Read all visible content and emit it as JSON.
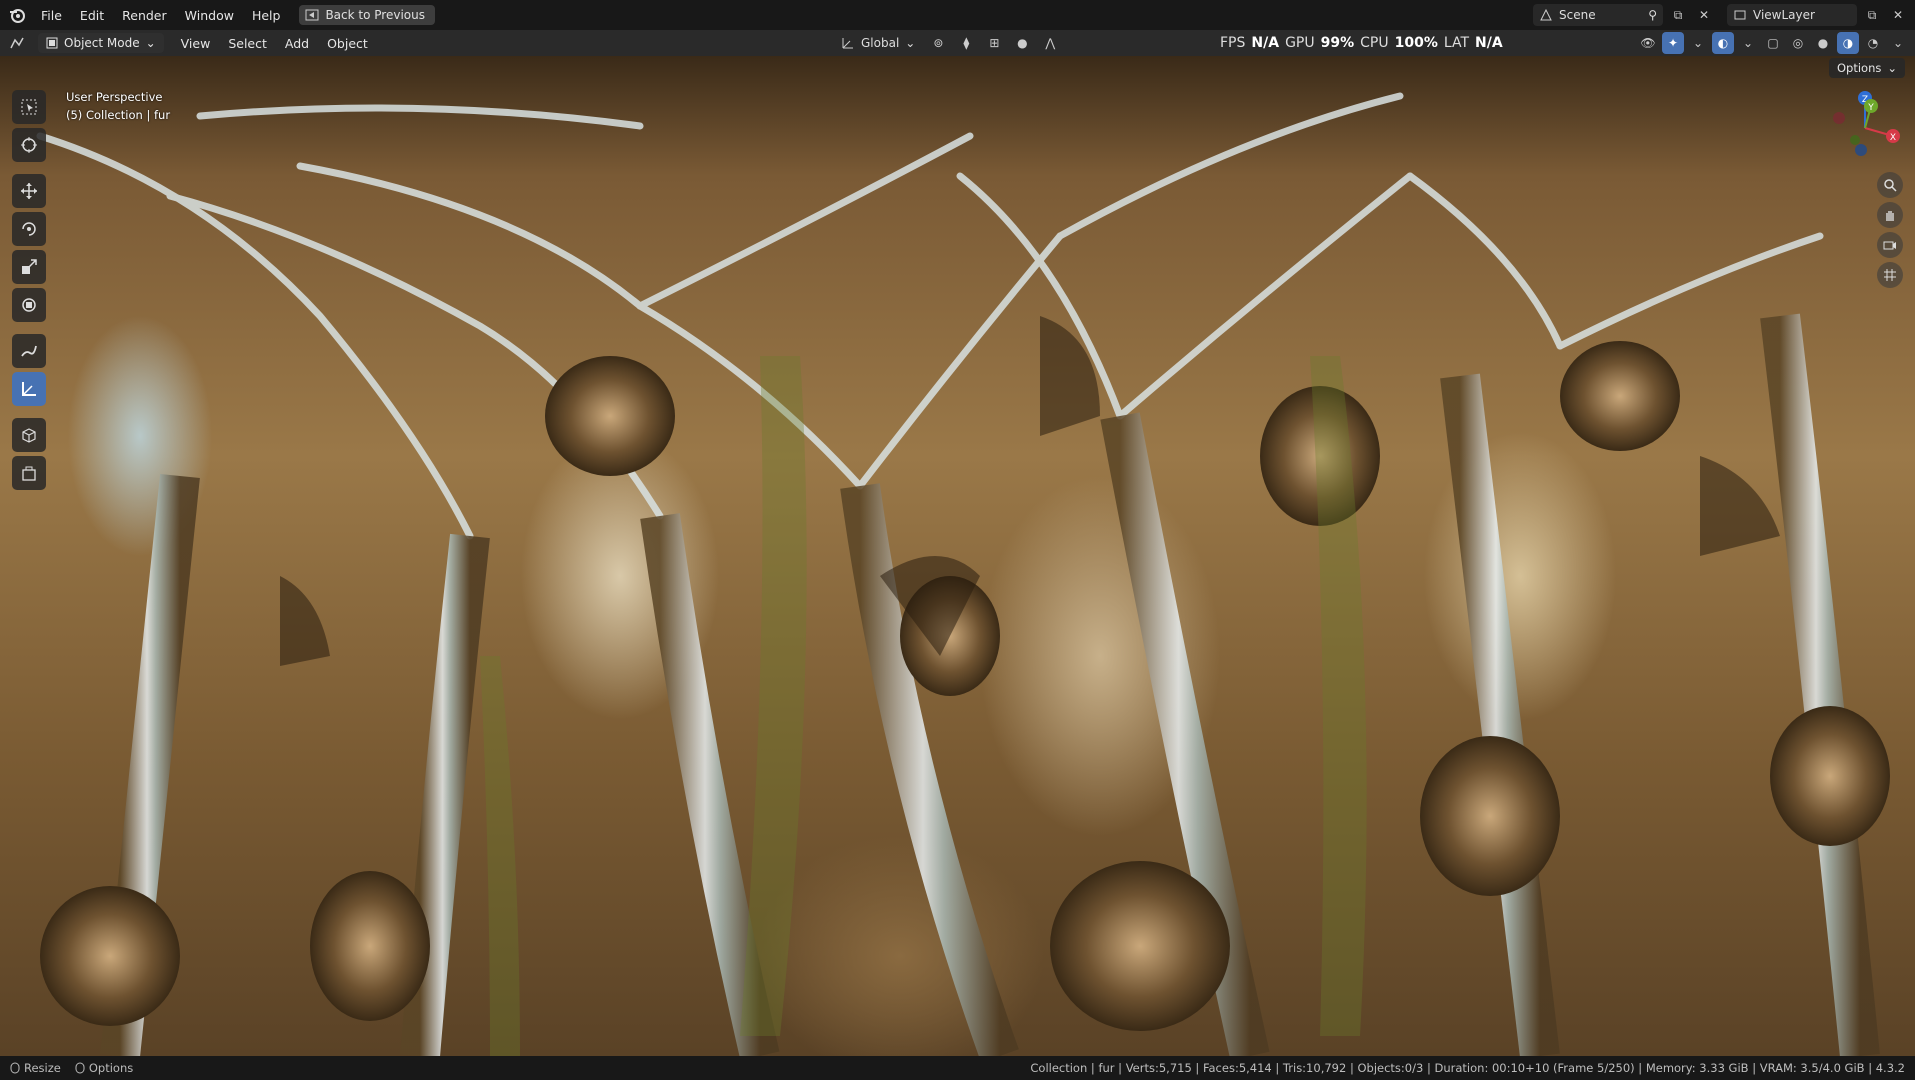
{
  "menubar": {
    "items": [
      "File",
      "Edit",
      "Render",
      "Window",
      "Help"
    ],
    "back_button": "Back to Previous"
  },
  "topright": {
    "scene_label": "Scene",
    "viewlayer_label": "ViewLayer"
  },
  "header": {
    "mode": "Object Mode",
    "menu": [
      "View",
      "Select",
      "Add",
      "Object"
    ],
    "transform_orientation": "Global"
  },
  "stats": {
    "fps_label": "FPS",
    "fps_value": "N/A",
    "gpu_label": "GPU",
    "gpu_value": "99%",
    "cpu_label": "CPU",
    "cpu_value": "100%",
    "lat_label": "LAT",
    "lat_value": "N/A"
  },
  "viewport": {
    "perspective": "User Perspective",
    "collection": "(5) Collection | fur",
    "options_label": "Options"
  },
  "gizmo": {
    "x": "X",
    "y": "Y",
    "z": "Z"
  },
  "statusbar": {
    "resize": "Resize",
    "options": "Options",
    "info": "Collection | fur | Verts:5,715 | Faces:5,414 | Tris:10,792 | Objects:0/3 | Duration: 00:10+10 (Frame 5/250) | Memory: 3.33 GiB | VRAM: 3.5/4.0 GiB | 4.3.2"
  },
  "colors": {
    "accent": "#4772b3",
    "header": "#2a2a2a",
    "topbar": "#181818"
  }
}
